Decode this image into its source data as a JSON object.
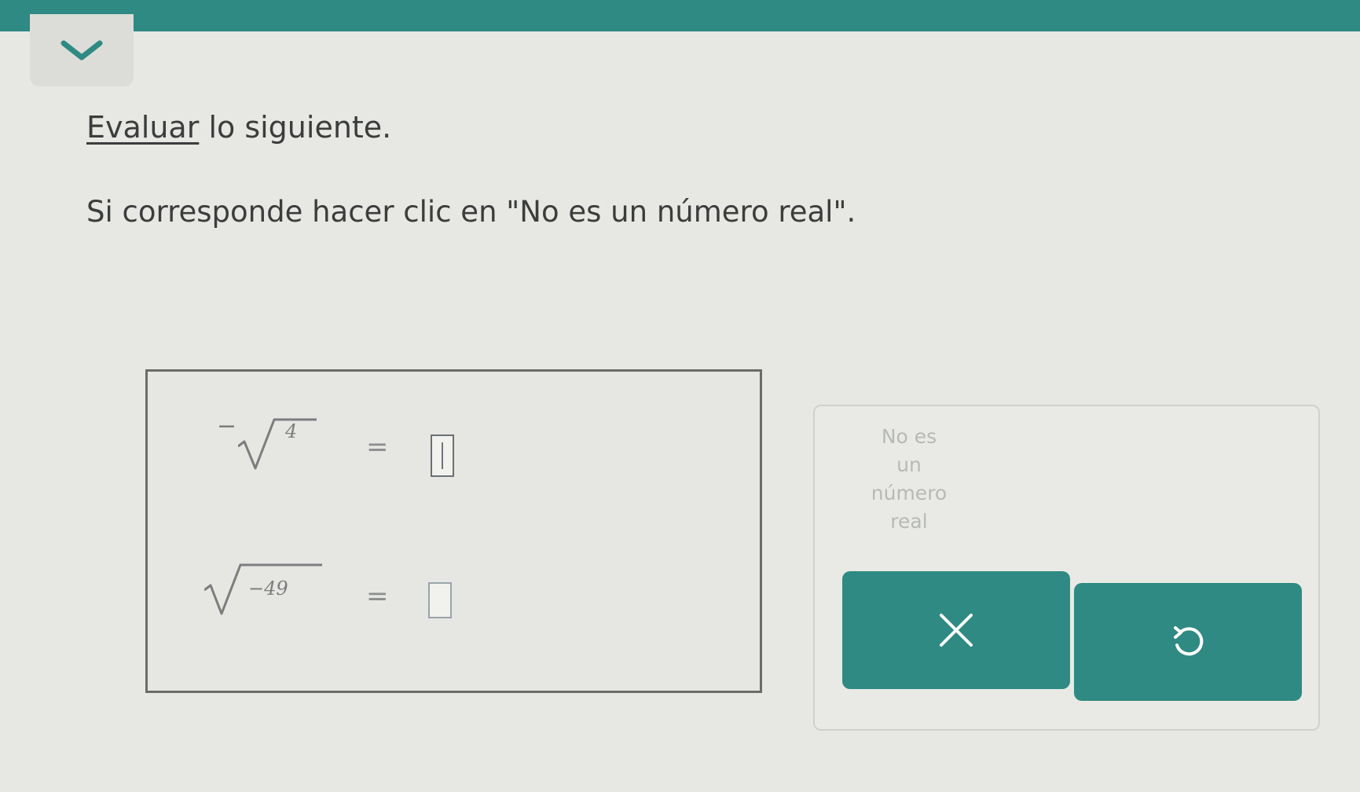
{
  "instructions": {
    "line1_link": "Evaluar",
    "line1_rest": "lo siguiente.",
    "line2": "Si corresponde hacer clic en \"No es un número real\"."
  },
  "equations": [
    {
      "prefix": "−",
      "radicand": "4",
      "equals": "=",
      "answer": ""
    },
    {
      "prefix": "",
      "radicand": "−49",
      "equals": "=",
      "answer": ""
    }
  ],
  "not_real_button": {
    "lines": [
      "No es",
      "un",
      "número",
      "real"
    ]
  },
  "icons": {
    "collapse": "chevron-down-icon",
    "clear": "close-icon",
    "undo": "undo-icon"
  },
  "colors": {
    "accent": "#2e8a82",
    "background": "#e7e8e3",
    "icon": "#ffffff"
  }
}
